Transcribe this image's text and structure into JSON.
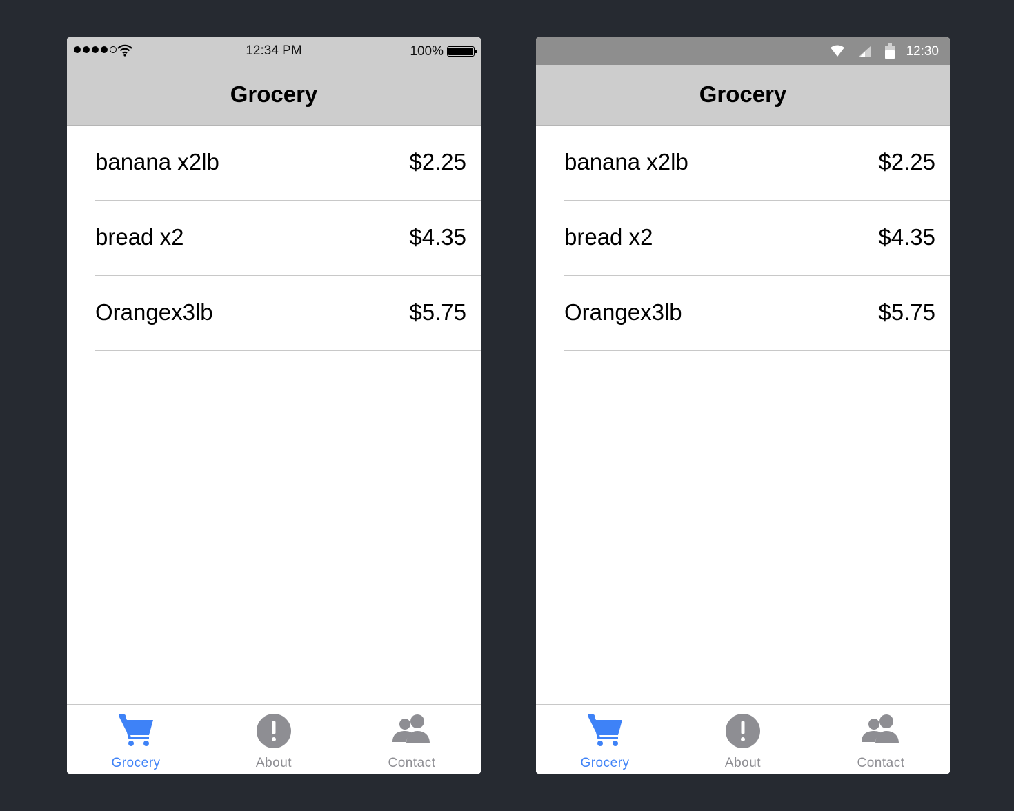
{
  "ios": {
    "status": {
      "time": "12:34 PM",
      "battery_pct": "100%"
    },
    "title": "Grocery",
    "items": [
      {
        "name": "banana x2lb",
        "price": "$2.25"
      },
      {
        "name": "bread x2",
        "price": "$4.35"
      },
      {
        "name": "Orangex3lb",
        "price": "$5.75"
      }
    ],
    "tabs": [
      {
        "label": "Grocery",
        "icon": "cart-icon",
        "active": true
      },
      {
        "label": "About",
        "icon": "info-exclamation-icon",
        "active": false
      },
      {
        "label": "Contact",
        "icon": "people-icon",
        "active": false
      }
    ]
  },
  "android": {
    "status": {
      "time": "12:30"
    },
    "title": "Grocery",
    "items": [
      {
        "name": "banana x2lb",
        "price": "$2.25"
      },
      {
        "name": "bread x2",
        "price": "$4.35"
      },
      {
        "name": "Orangex3lb",
        "price": "$5.75"
      }
    ],
    "tabs": [
      {
        "label": "Grocery",
        "icon": "cart-icon",
        "active": true
      },
      {
        "label": "About",
        "icon": "info-exclamation-icon",
        "active": false
      },
      {
        "label": "Contact",
        "icon": "people-icon",
        "active": false
      }
    ]
  },
  "colors": {
    "background": "#262a31",
    "bar": "#cdcdcd",
    "android_status": "#8e8e8e",
    "accent": "#3e82f7",
    "inactive": "#8e8e93"
  }
}
